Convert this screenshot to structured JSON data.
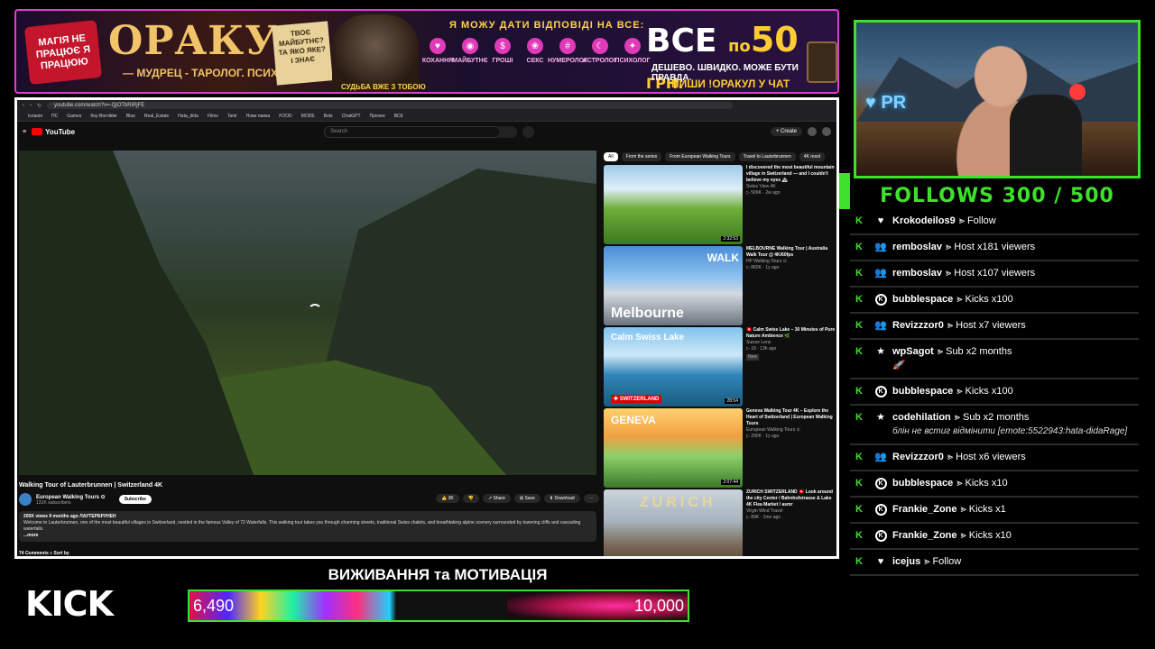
{
  "banner": {
    "left_badge": "МАГІЯ НЕ ПРАЦЮЄ Я ПРАЦЮЮ",
    "title": "ОРАКУЛ",
    "subtitle": "— МУДРЕЦ - ТАРОЛОГ. ПСИХОЛОГ. —",
    "note": "ТВОЄ МАЙБУТНЄ? ТА ЯКО ЯКЕ? І ЗНАЄ",
    "wizard_tag": "СУДЬБА ВЖЕ З ТОБОЮ",
    "answers": "Я МОЖУ ДАТИ ВІДПОВІДІ НА ВСЕ:",
    "categories": [
      {
        "label": "КОХАННЯ",
        "icon": "heart-icon"
      },
      {
        "label": "МАЙБУТНЄ",
        "icon": "crystal-ball-icon"
      },
      {
        "label": "ГРОШІ",
        "icon": "money-icon"
      },
      {
        "label": "СЕКС",
        "icon": "peach-icon"
      },
      {
        "label": "НУМЕРОЛОГ",
        "icon": "numbers-icon"
      },
      {
        "label": "АСТРОЛОГ",
        "icon": "moon-icon"
      },
      {
        "label": "ПСИХОЛОГ",
        "icon": "brain-icon"
      }
    ],
    "price_main": "ВСЕ",
    "price_po": "по",
    "price_value": "50",
    "price_currency": "ГРН.",
    "price_sub": "ДЕШЕВО. ШВИДКО. МОЖЕ БУТИ ПРАВДА.",
    "price_cta": "ПИШИ !ОРАКУЛ У ЧАТ"
  },
  "browser": {
    "url": "youtube.com/watch?v=-QjOTbRiRjFE",
    "bookmarks": [
      "Іспанія",
      "ПС",
      "Games",
      "Кey-Воrnikler",
      "Blue",
      "Real_Estate",
      "Hata_dida",
      "Films",
      "Tanir",
      "Нове папка",
      "FOOD",
      "MODE",
      "Bots",
      "ChatGPT",
      "Прочее",
      "ВСЕ"
    ],
    "yt": {
      "logo_text": "YouTube",
      "search_placeholder": "Search",
      "create_label": "+ Create",
      "video_title": "Walking Tour of Lauterbrunnen | Switzerland 4K",
      "channel_name": "European Walking Tours ⊙",
      "channel_subs": "131K subscribers",
      "subscribe_label": "Subscribe",
      "actions": [
        "👍 3K",
        "👎",
        "↗ Share",
        "⊞ Save",
        "⬇ Download",
        "⋯"
      ],
      "desc_meta": "205K views  9 months ago  ЛАУТЕРБРУНЕН",
      "desc_text": "Welcome to Lauterbrunnen, one of the most beautiful villages in Switzerland, nestled in the famous Valley of 72 Waterfalls. This walking tour takes you through charming streets, traditional Swiss chalets, and breathtaking alpine scenery surrounded by towering cliffs and cascading waterfalls.",
      "desc_more": "...more",
      "comments": "74 Comments    ≡ Sort by",
      "chips": [
        "All",
        "From the series",
        "From European Walking Tours",
        "Travel to Lauterbrunnen",
        "4K resol"
      ],
      "recs": [
        {
          "title": "I discovered the most beautiful mountain village in Switzerland — and I couldn't believe my eyes 🏔",
          "channel": "Swiss View 4K",
          "meta": "▷ 509K · 2w ago",
          "duration": "2:32:53",
          "thumb_label": ""
        },
        {
          "title": "MELBOURNE Walking Tour | Australia Walk Tour @ 4K/60fps",
          "channel": "HP Walking Tours ⊙",
          "meta": "▷ 860K · 1y ago",
          "duration": "",
          "thumb_label": "WALK",
          "thumb_label2": "Melbourne"
        },
        {
          "title": "🇨🇭 Calm Swiss Lake – 30 Minutes of Pure Nature Ambience 🌿",
          "channel": "Suisse Lens",
          "meta": "▷ 18 · 13h ago",
          "duration": "28:54",
          "thumb_label": "Calm Swiss Lake",
          "thumb_label2": "✚ SWITZERLAND",
          "badge": "New"
        },
        {
          "title": "Geneva Walking Tour 4K – Explore the Heart of Switzerland | European Walking Tours",
          "channel": "European Walking Tours ⊙",
          "meta": "▷ 290K · 1y ago",
          "duration": "2:07:44",
          "thumb_label": "GENEVA"
        },
        {
          "title": "ZURICH SWITZERLAND 🇨🇭 Look around the city Center / Bahnhofstrasse & Lake 4K Flea Market / asmr",
          "channel": "Virgin Wind Travel",
          "meta": "▷ 89K · 1mo ago",
          "duration": "",
          "thumb_label": "ZURICH"
        }
      ]
    }
  },
  "goal": {
    "label": "FOLLOWS 300 / 500"
  },
  "events": [
    {
      "icon": "heart-icon",
      "glyph": "♥",
      "name": "Krokodeilos9",
      "text": "⪢ Follow",
      "extra": ""
    },
    {
      "icon": "host-icon",
      "glyph": "👥",
      "name": "remboslav",
      "text": "⪢ Host x181 viewers",
      "extra": ""
    },
    {
      "icon": "host-icon",
      "glyph": "👥",
      "name": "remboslav",
      "text": "⪢ Host x107 viewers",
      "extra": ""
    },
    {
      "icon": "kicks-icon",
      "glyph": "K",
      "name": "bubblespace",
      "text": "⪢ Kicks x100",
      "extra": ""
    },
    {
      "icon": "host-icon",
      "glyph": "👥",
      "name": "Revizzzor0",
      "text": "⪢ Host x7 viewers",
      "extra": ""
    },
    {
      "icon": "star-icon",
      "glyph": "★",
      "name": "wpSagot",
      "text": "⪢ Sub x2 months",
      "extra": "🚀"
    },
    {
      "icon": "kicks-icon",
      "glyph": "K",
      "name": "bubblespace",
      "text": "⪢ Kicks x100",
      "extra": ""
    },
    {
      "icon": "star-icon",
      "glyph": "★",
      "name": "codehilation",
      "text": "⪢ Sub x2 months",
      "extra": "блін не встиг відмінити [emote:5522943:hata-didaRage]"
    },
    {
      "icon": "host-icon",
      "glyph": "👥",
      "name": "Revizzzor0",
      "text": "⪢ Host x6 viewers",
      "extra": ""
    },
    {
      "icon": "kicks-icon",
      "glyph": "K",
      "name": "bubblespace",
      "text": "⪢ Kicks x10",
      "extra": ""
    },
    {
      "icon": "kicks-icon",
      "glyph": "K",
      "name": "Frankie_Zone",
      "text": "⪢ Kicks x1",
      "extra": ""
    },
    {
      "icon": "kicks-icon",
      "glyph": "K",
      "name": "Frankie_Zone",
      "text": "⪢ Kicks x10",
      "extra": ""
    },
    {
      "icon": "heart-icon",
      "glyph": "♥",
      "name": "icejus",
      "text": "⪢ Follow",
      "extra": ""
    }
  ],
  "bottom": {
    "kick_logo": "KICK",
    "motivation_title": "ВИЖИВАННЯ та МОТИВАЦІЯ",
    "current": "6,490",
    "max": "10,000",
    "progress": 0.649
  },
  "colors": {
    "accent": "#3ee02b",
    "banner_border": "#e23bd6"
  }
}
